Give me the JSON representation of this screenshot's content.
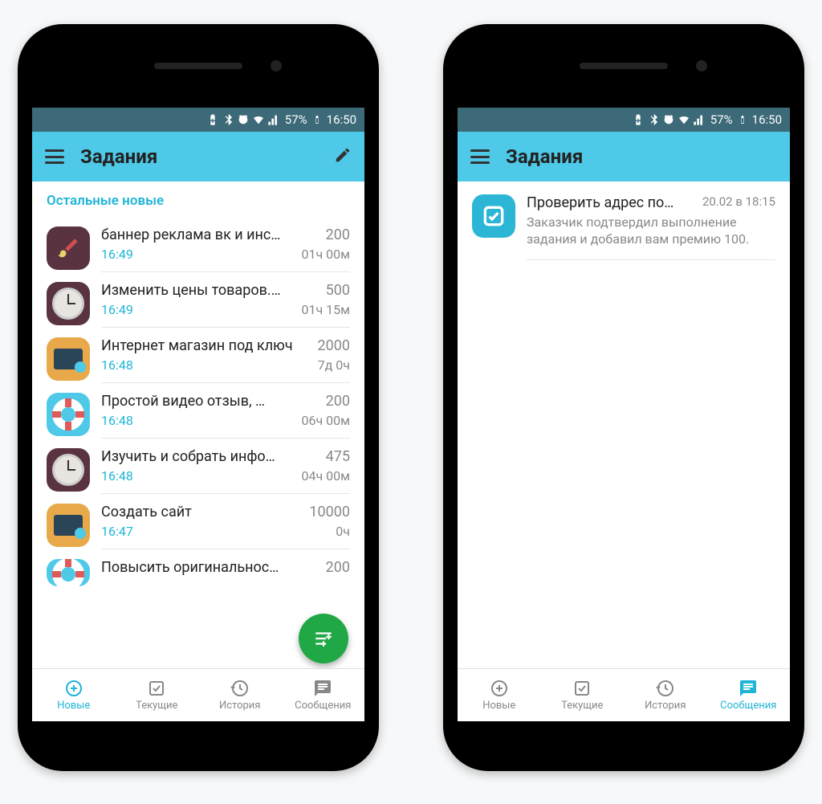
{
  "statusbar": {
    "battery_pct": "57%",
    "time": "16:50"
  },
  "phone_left": {
    "header": {
      "title": "Задания"
    },
    "section_label": "Остальные новые",
    "tasks": [
      {
        "title": "баннер реклама вк и инс…",
        "price": "200",
        "time": "16:49",
        "duration": "01ч 00м",
        "icon": "brush"
      },
      {
        "title": "Изменить цены товаров.…",
        "price": "500",
        "time": "16:49",
        "duration": "01ч 15м",
        "icon": "clock"
      },
      {
        "title": "Интернет магазин под ключ",
        "price": "2000",
        "time": "16:48",
        "duration": "7д 0ч",
        "icon": "monitor"
      },
      {
        "title": "Простой  видео отзыв, …",
        "price": "200",
        "time": "16:48",
        "duration": "06ч 00м",
        "icon": "life"
      },
      {
        "title": "Изучить и собрать инфо…",
        "price": "475",
        "time": "16:48",
        "duration": "04ч 00м",
        "icon": "clock"
      },
      {
        "title": "Создать сайт",
        "price": "10000",
        "time": "16:47",
        "duration": "0ч",
        "icon": "monitor"
      }
    ],
    "partial_task": {
      "title": "Повысить оригинальнос…",
      "price": "200",
      "icon": "life"
    }
  },
  "phone_right": {
    "header": {
      "title": "Задания"
    },
    "messages": [
      {
        "title": "Проверить адрес по…",
        "date": "20.02 в 18:15",
        "text": "Заказчик подтвердил выполнение задания и добавил вам премию 100."
      }
    ]
  },
  "nav": {
    "new": "Новые",
    "current": "Текущие",
    "history": "История",
    "messages": "Сообщения"
  }
}
